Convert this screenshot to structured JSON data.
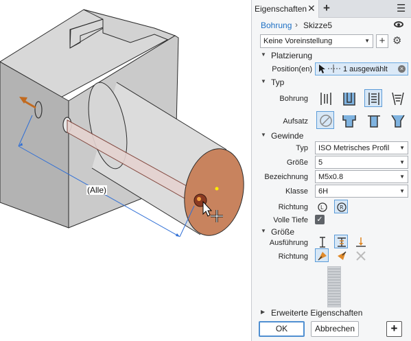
{
  "viewport": {
    "dimension_label": "(Alle)"
  },
  "panel": {
    "tab_title": "Eigenschaften",
    "tab_close": "✕",
    "tab_add": "+",
    "menu_icon": "☰",
    "breadcrumb": {
      "feature": "Bohrung",
      "separator": "›",
      "sketch": "Skizze5"
    },
    "preset": {
      "value": "Keine Voreinstellung",
      "add_label": "+"
    },
    "sections": {
      "placement": "Platzierung",
      "type": "Typ",
      "thread": "Gewinde",
      "size": "Größe",
      "advanced": "Erweiterte Eigenschaften"
    },
    "placement": {
      "position_label": "Position(en)",
      "position_value": "1 ausgewählt",
      "clear_icon": "×"
    },
    "type": {
      "hole_label": "Bohrung",
      "seat_label": "Aufsatz"
    },
    "thread": {
      "type_label": "Typ",
      "type_value": "ISO Metrisches Profil",
      "size_label": "Größe",
      "size_value": "5",
      "designation_label": "Bezeichnung",
      "designation_value": "M5x0.8",
      "class_label": "Klasse",
      "class_value": "6H",
      "direction_label": "Richtung",
      "full_depth_label": "Volle Tiefe",
      "full_depth_checked": true
    },
    "size": {
      "execution_label": "Ausführung",
      "direction_label": "Richtung"
    },
    "buttons": {
      "ok": "OK",
      "cancel": "Abbrechen",
      "add": "+"
    },
    "colors": {
      "accent": "#1c6fc4",
      "selection": "#d7e7f6",
      "selection_border": "#5a9bd8",
      "face": "#c8835e"
    }
  }
}
